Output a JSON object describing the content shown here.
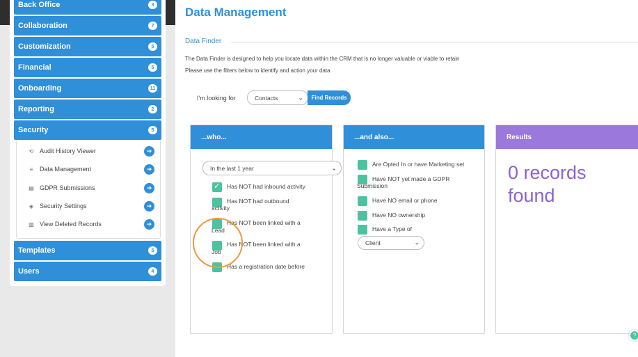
{
  "sidebar": {
    "nav": [
      {
        "label": "Back Office",
        "count": "3"
      },
      {
        "label": "Collaboration",
        "count": "7"
      },
      {
        "label": "Customization",
        "count": "5"
      },
      {
        "label": "Financial",
        "count": "5"
      },
      {
        "label": "Onboarding",
        "count": "11"
      },
      {
        "label": "Reporting",
        "count": "2"
      },
      {
        "label": "Security",
        "count": "5"
      },
      {
        "label": "Templates",
        "count": "5"
      },
      {
        "label": "Users",
        "count": "4"
      }
    ],
    "security_items": [
      {
        "label": "Audit History Viewer",
        "icon": "history-icon"
      },
      {
        "label": "Data Management",
        "icon": "database-icon"
      },
      {
        "label": "GDPR Submissions",
        "icon": "document-icon"
      },
      {
        "label": "Security Settings",
        "icon": "shield-icon"
      },
      {
        "label": "View Deleted Records",
        "icon": "trash-icon"
      }
    ]
  },
  "main": {
    "title": "Data Management",
    "section": "Data Finder",
    "desc1": "The Data Finder is designed to help you locate data within the CRM that is no longer valuable or viable to retain",
    "desc2": "Please use the filters below to identify and action your data",
    "looking_label": "I'm looking for",
    "looking_value": "Contacts",
    "find_button": "Find Records"
  },
  "who": {
    "header": "...who...",
    "period": "In the last 1 year",
    "options": [
      {
        "l1": "Has NOT had inbound activity",
        "l2": "",
        "checked": true
      },
      {
        "l1": "Has NOT had outbound",
        "l2": "activity",
        "checked": false
      },
      {
        "l1": "Has NOT been linked with a",
        "l2": "Lead",
        "checked": false
      },
      {
        "l1": "Has NOT been linked with a",
        "l2": "Job",
        "checked": false
      },
      {
        "l1": "Has a registration date before",
        "l2": "",
        "checked": false
      }
    ]
  },
  "also": {
    "header": "...and also...",
    "options": [
      {
        "l1": "Are Opted In or have Marketing set",
        "l2": ""
      },
      {
        "l1": "Have NOT yet made a GDPR",
        "l2": "Submission"
      },
      {
        "l1": "Have NO email or phone",
        "l2": ""
      },
      {
        "l1": "Have NO ownership",
        "l2": ""
      },
      {
        "l1": "Have a Type of",
        "l2": ""
      }
    ],
    "type_value": "Client"
  },
  "results": {
    "header": "Results",
    "line1": "0 records",
    "line2": "found"
  },
  "colors": {
    "primary": "#2f8fd8",
    "results_header": "#9b78db",
    "results_text": "#8b63d1",
    "checkbox": "#4cc3a0",
    "highlight": "#ee9a3d"
  }
}
